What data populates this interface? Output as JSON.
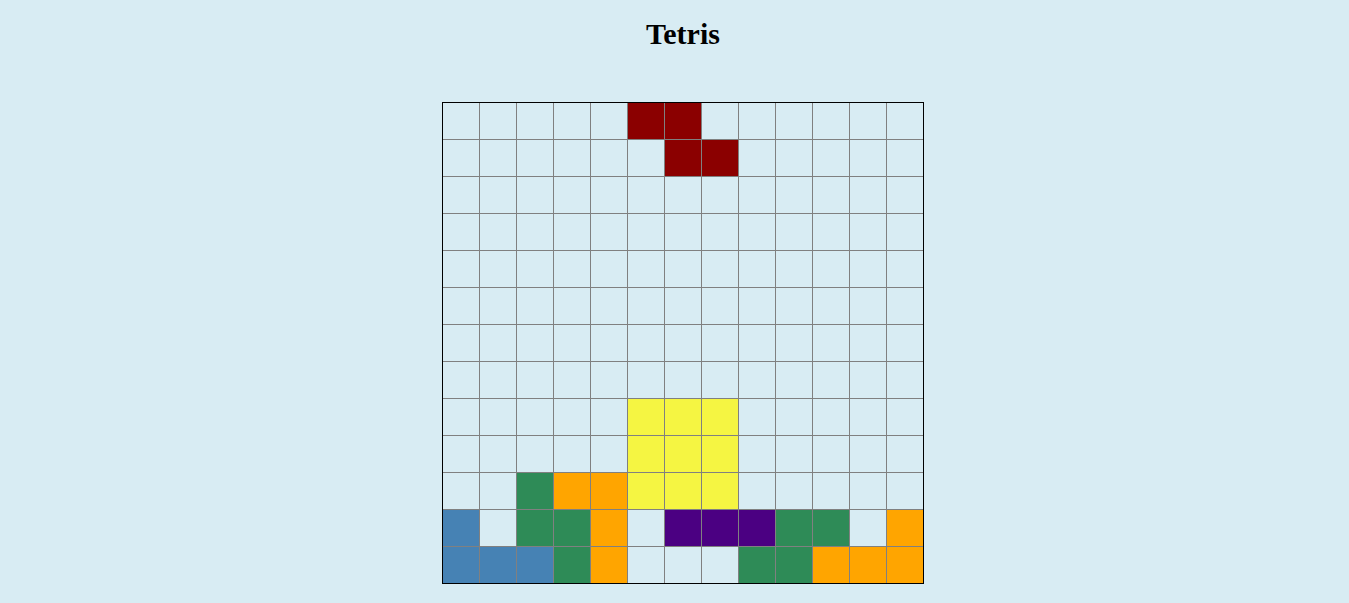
{
  "title": "Tetris",
  "board": [
    [
      null,
      null,
      null,
      null,
      null,
      "#8b0000",
      "#8b0000",
      null,
      null,
      null,
      null,
      null,
      null
    ],
    [
      null,
      null,
      null,
      null,
      null,
      null,
      "#8b0000",
      "#8b0000",
      null,
      null,
      null,
      null,
      null
    ],
    [
      null,
      null,
      null,
      null,
      null,
      null,
      null,
      null,
      null,
      null,
      null,
      null,
      null
    ],
    [
      null,
      null,
      null,
      null,
      null,
      null,
      null,
      null,
      null,
      null,
      null,
      null,
      null
    ],
    [
      null,
      null,
      null,
      null,
      null,
      null,
      null,
      null,
      null,
      null,
      null,
      null,
      null
    ],
    [
      null,
      null,
      null,
      null,
      null,
      null,
      null,
      null,
      null,
      null,
      null,
      null,
      null
    ],
    [
      null,
      null,
      null,
      null,
      null,
      null,
      null,
      null,
      null,
      null,
      null,
      null,
      null
    ],
    [
      null,
      null,
      null,
      null,
      null,
      null,
      null,
      null,
      null,
      null,
      null,
      null,
      null
    ],
    [
      null,
      null,
      null,
      null,
      null,
      "#f5f542",
      "#f5f542",
      "#f5f542",
      null,
      null,
      null,
      null,
      null
    ],
    [
      null,
      null,
      null,
      null,
      null,
      "#f5f542",
      "#f5f542",
      "#f5f542",
      null,
      null,
      null,
      null,
      null
    ],
    [
      null,
      null,
      "#2e8b57",
      "#ffa500",
      "#ffa500",
      "#f5f542",
      "#f5f542",
      "#f5f542",
      null,
      null,
      null,
      null,
      null
    ],
    [
      "#4682b4",
      null,
      "#2e8b57",
      "#2e8b57",
      "#ffa500",
      null,
      "#4b0082",
      "#4b0082",
      "#4b0082",
      "#2e8b57",
      "#2e8b57",
      null,
      "#ffa500"
    ],
    [
      "#4682b4",
      "#4682b4",
      "#4682b4",
      "#2e8b57",
      "#ffa500",
      null,
      null,
      null,
      "#2e8b57",
      "#2e8b57",
      "#ffa500",
      "#ffa500",
      "#ffa500"
    ]
  ]
}
